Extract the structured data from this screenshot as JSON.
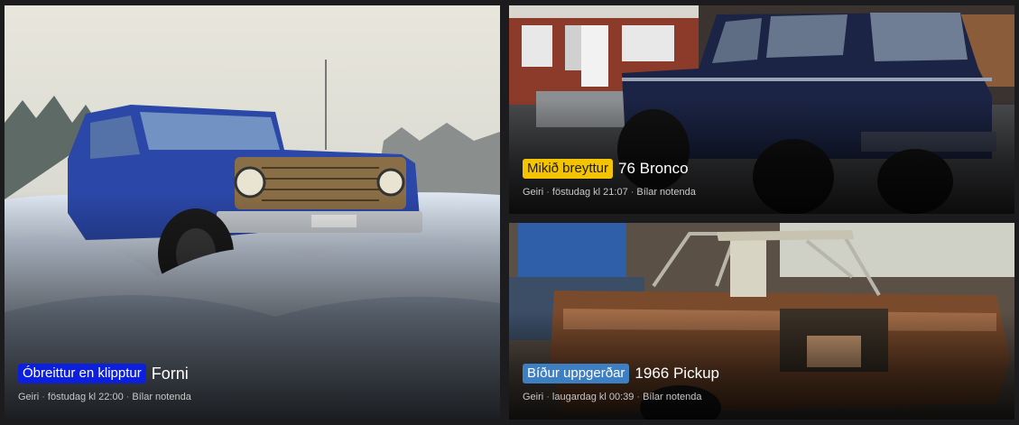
{
  "cards": [
    {
      "badge": "Óbreittur en klipptur",
      "badge_bg": "#0b1fdc",
      "badge_fg": "#ffffff",
      "title": "Forni",
      "author": "Geiri",
      "date": "föstudag kl 22:00",
      "forum": "Bílar notenda"
    },
    {
      "badge": "Mikið breyttur",
      "badge_bg": "#f5c400",
      "badge_fg": "#1a1a1a",
      "title": "76 Bronco",
      "author": "Geiri",
      "date": "föstudag kl 21:07",
      "forum": "Bílar notenda"
    },
    {
      "badge": "Bíður uppgerðar",
      "badge_bg": "#3d7fc1",
      "badge_fg": "#ffffff",
      "title": "1966 Pickup",
      "author": "Geiri",
      "date": "laugardag kl 00:39",
      "forum": "Bílar notenda"
    }
  ],
  "meta_separator": "·"
}
